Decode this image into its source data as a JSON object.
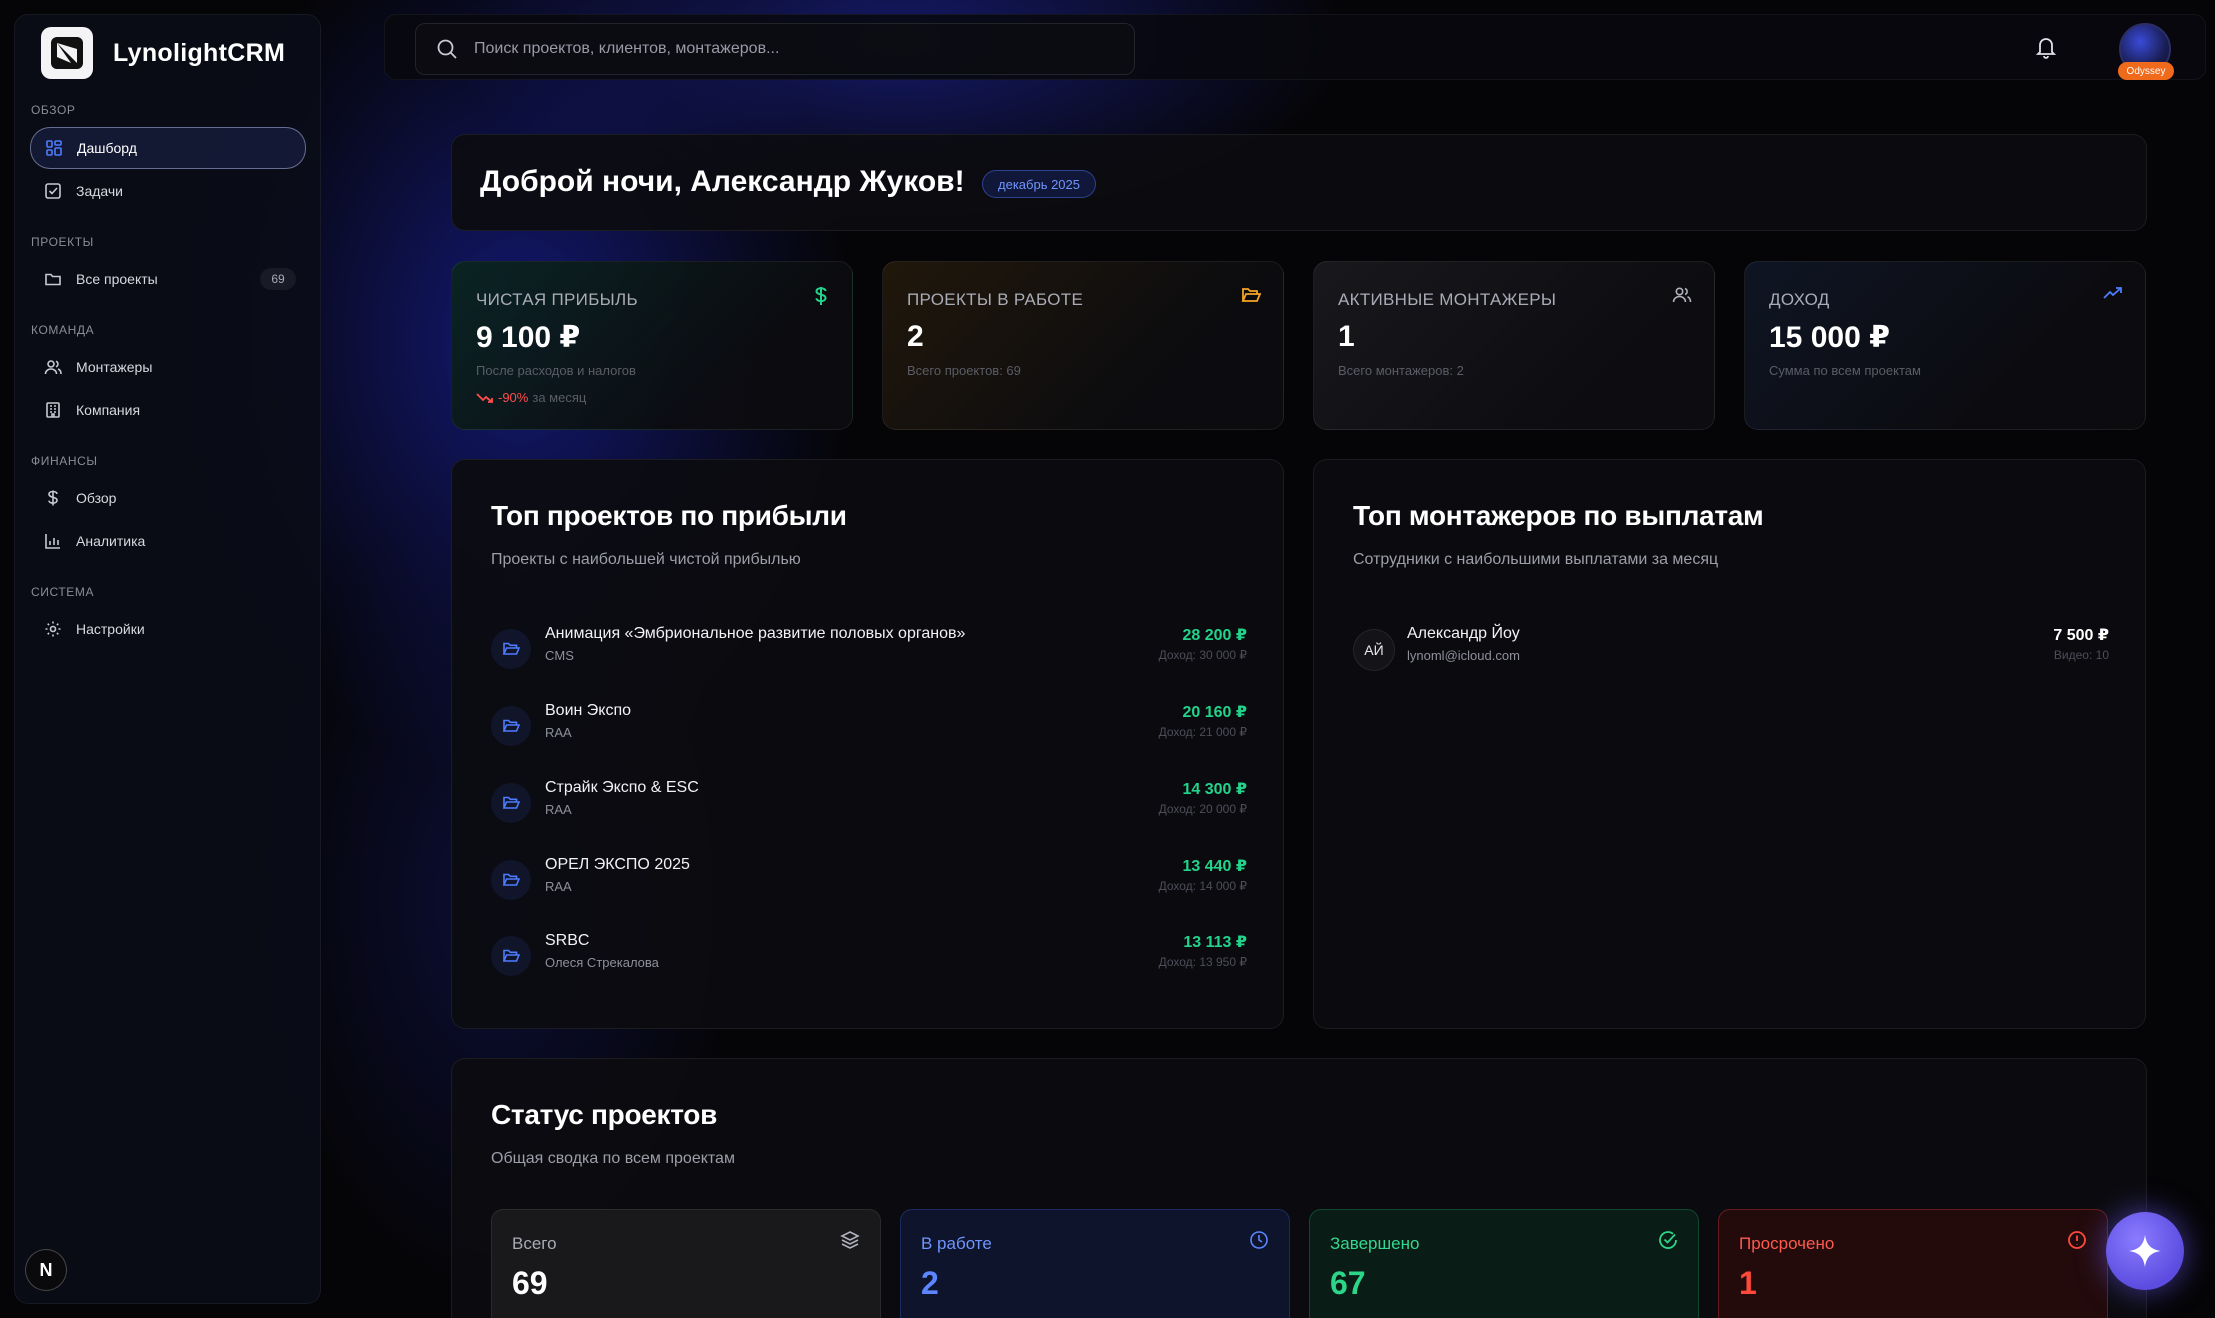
{
  "app": {
    "name": "LynolightCRM"
  },
  "sidebar": {
    "sections": [
      {
        "title": "ОБЗОР"
      },
      {
        "title": "ПРОЕКТЫ"
      },
      {
        "title": "КОМАНДА"
      },
      {
        "title": "ФИНАНСЫ"
      },
      {
        "title": "СИСТЕМА"
      }
    ],
    "items": [
      {
        "label": "Дашборд",
        "icon": "dashboard-icon"
      },
      {
        "label": "Задачи",
        "icon": "checkbox-icon"
      },
      {
        "label": "Все проекты",
        "icon": "folder-icon",
        "badge": "69"
      },
      {
        "label": "Монтажеры",
        "icon": "users-icon"
      },
      {
        "label": "Компания",
        "icon": "building-icon"
      },
      {
        "label": "Обзор",
        "icon": "dollar-icon"
      },
      {
        "label": "Аналитика",
        "icon": "bar-chart-icon"
      },
      {
        "label": "Настройки",
        "icon": "gear-icon"
      }
    ],
    "footer_badge": "N"
  },
  "header": {
    "search_placeholder": "Поиск проектов, клиентов, монтажеров...",
    "avatar_tag": "Odyssey"
  },
  "greeting": {
    "text": "Доброй ночи, Александр Жуков!",
    "period": "декабрь 2025"
  },
  "stats": [
    {
      "label": "ЧИСТАЯ ПРИБЫЛЬ",
      "value": "9 100 ₽",
      "sub": "После расходов и налогов",
      "trend": "-90%",
      "trend_suffix": "за месяц",
      "icon": "dollar-icon",
      "color": "#22d38b"
    },
    {
      "label": "ПРОЕКТЫ В РАБОТЕ",
      "value": "2",
      "sub": "Всего проектов: 69",
      "icon": "folder-open-icon",
      "color": "#f5a524"
    },
    {
      "label": "АКТИВНЫЕ МОНТАЖЕРЫ",
      "value": "1",
      "sub": "Всего монтажеров: 2",
      "icon": "users-icon",
      "color": "#b0b2bc"
    },
    {
      "label": "ДОХОД",
      "value": "15 000 ₽",
      "sub": "Сумма по всем проектам",
      "icon": "trending-up-icon",
      "color": "#4d7cff"
    }
  ],
  "top_projects": {
    "title": "Топ проектов по прибыли",
    "subtitle": "Проекты с наибольшей чистой прибылью",
    "rows": [
      {
        "name": "Анимация «Эмбриональное развитие половых органов»",
        "client": "CMS",
        "profit": "28 200 ₽",
        "income": "Доход: 30 000 ₽"
      },
      {
        "name": "Воин Экспо",
        "client": "RAA",
        "profit": "20 160 ₽",
        "income": "Доход: 21 000 ₽"
      },
      {
        "name": "Страйк Экспо & ESC",
        "client": "RAA",
        "profit": "14 300 ₽",
        "income": "Доход: 20 000 ₽"
      },
      {
        "name": "ОРЕЛ ЭКСПО 2025",
        "client": "RAA",
        "profit": "13 440 ₽",
        "income": "Доход: 14 000 ₽"
      },
      {
        "name": "SRBC",
        "client": "Олеся Стрекалова",
        "profit": "13 113 ₽",
        "income": "Доход: 13 950 ₽"
      }
    ]
  },
  "top_editors": {
    "title": "Топ монтажеров по выплатам",
    "subtitle": "Сотрудники с наибольшими выплатами за месяц",
    "rows": [
      {
        "initials": "АЙ",
        "name": "Александр Йоу",
        "email": "lynoml@icloud.com",
        "payout": "7 500 ₽",
        "videos": "Видео: 10"
      }
    ]
  },
  "status": {
    "title": "Статус проектов",
    "subtitle": "Общая сводка по всем проектам",
    "cards": [
      {
        "label": "Всего",
        "value": "69",
        "icon": "layers-icon"
      },
      {
        "label": "В работе",
        "value": "2",
        "icon": "clock-icon"
      },
      {
        "label": "Завершено",
        "value": "67",
        "icon": "check-circle-icon"
      },
      {
        "label": "Просрочено",
        "value": "1",
        "icon": "alert-circle-icon"
      }
    ]
  },
  "fab": {
    "icon": "sparkle-icon"
  }
}
